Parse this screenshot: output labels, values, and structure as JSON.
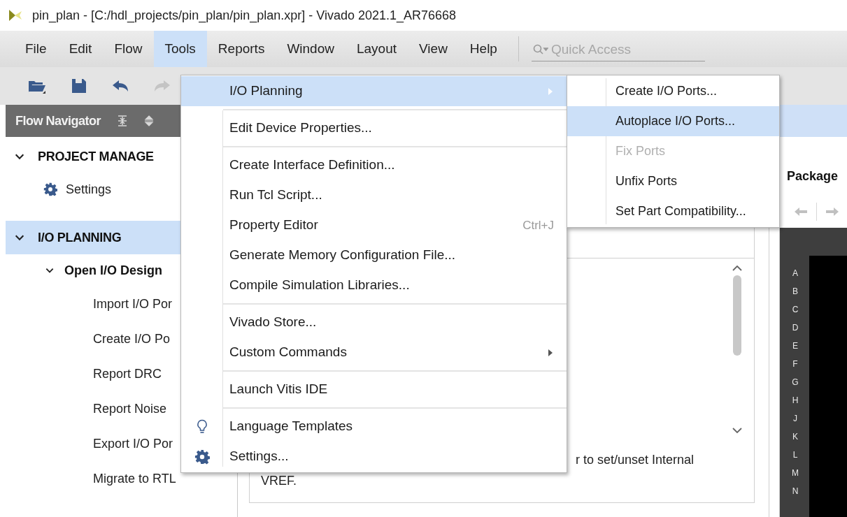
{
  "window": {
    "title": "pin_plan - [C:/hdl_projects/pin_plan/pin_plan.xpr] - Vivado 2021.1_AR76668"
  },
  "menu_bar": [
    {
      "label": "File",
      "selected": false
    },
    {
      "label": "Edit",
      "selected": false
    },
    {
      "label": "Flow",
      "selected": false
    },
    {
      "label": "Tools",
      "selected": true
    },
    {
      "label": "Reports",
      "selected": false
    },
    {
      "label": "Window",
      "selected": false
    },
    {
      "label": "Layout",
      "selected": false
    },
    {
      "label": "View",
      "selected": false
    },
    {
      "label": "Help",
      "selected": false
    }
  ],
  "quick_access": {
    "placeholder": "Quick Access"
  },
  "flow_navigator": {
    "title": "Flow Navigator",
    "sections": [
      {
        "label": "PROJECT MANAGE",
        "expanded": true,
        "selected": false,
        "children": [
          {
            "label": "Settings",
            "kind": "setting"
          }
        ]
      },
      {
        "label": "I/O PLANNING",
        "expanded": true,
        "selected": true,
        "children": [
          {
            "label": "Open I/O Design",
            "kind": "group",
            "expanded": true,
            "children": [
              {
                "label": "Import I/O Por",
                "kind": "task"
              },
              {
                "label": "Create I/O Po",
                "kind": "task"
              },
              {
                "label": "Report DRC",
                "kind": "task"
              },
              {
                "label": "Report Noise",
                "kind": "task"
              },
              {
                "label": "Export I/O Por",
                "kind": "task"
              },
              {
                "label": "Migrate to RTL",
                "kind": "task"
              }
            ]
          }
        ]
      }
    ]
  },
  "tools_menu": {
    "items": [
      {
        "label": "I/O Planning",
        "kind": "command",
        "selected": true,
        "submenu": true
      },
      {
        "kind": "separator"
      },
      {
        "label": "Edit Device Properties...",
        "kind": "command",
        "selected": false,
        "submenu": false
      },
      {
        "kind": "separator"
      },
      {
        "label": "Create Interface Definition...",
        "kind": "command",
        "selected": false,
        "submenu": false
      },
      {
        "label": "Run Tcl Script...",
        "kind": "command",
        "selected": false,
        "submenu": false
      },
      {
        "label": "Property Editor",
        "kind": "command",
        "selected": false,
        "submenu": false,
        "shortcut": "Ctrl+J"
      },
      {
        "label": "Generate Memory Configuration File...",
        "kind": "command",
        "selected": false,
        "submenu": false
      },
      {
        "label": "Compile Simulation Libraries...",
        "kind": "command",
        "selected": false,
        "submenu": false
      },
      {
        "kind": "separator"
      },
      {
        "label": "Vivado Store...",
        "kind": "command",
        "selected": false,
        "submenu": false
      },
      {
        "label": "Custom Commands",
        "kind": "command",
        "selected": false,
        "submenu": true
      },
      {
        "kind": "separator"
      },
      {
        "label": "Launch Vitis IDE",
        "kind": "command",
        "selected": false,
        "submenu": false
      },
      {
        "kind": "separator"
      },
      {
        "label": "Language Templates",
        "kind": "templates",
        "selected": false,
        "submenu": false
      },
      {
        "label": "Settings...",
        "kind": "settings",
        "selected": false,
        "submenu": false
      }
    ]
  },
  "io_planning_submenu": {
    "items": [
      {
        "label": "Create I/O Ports...",
        "selected": false,
        "disabled": false
      },
      {
        "label": "Autoplace I/O Ports...",
        "selected": true,
        "disabled": false
      },
      {
        "label": "Fix Ports",
        "selected": false,
        "disabled": true
      },
      {
        "label": "Unfix Ports",
        "selected": false,
        "disabled": false
      },
      {
        "label": "Set Part Compatibility...",
        "selected": false,
        "disabled": false
      }
    ]
  },
  "description": {
    "lines": [
      "r to set/unset Internal",
      "VREF."
    ]
  },
  "package_panel": {
    "title": "Package",
    "row_labels": [
      "A",
      "B",
      "C",
      "D",
      "E",
      "F",
      "G",
      "H",
      "J",
      "K",
      "L",
      "M",
      "N"
    ]
  }
}
